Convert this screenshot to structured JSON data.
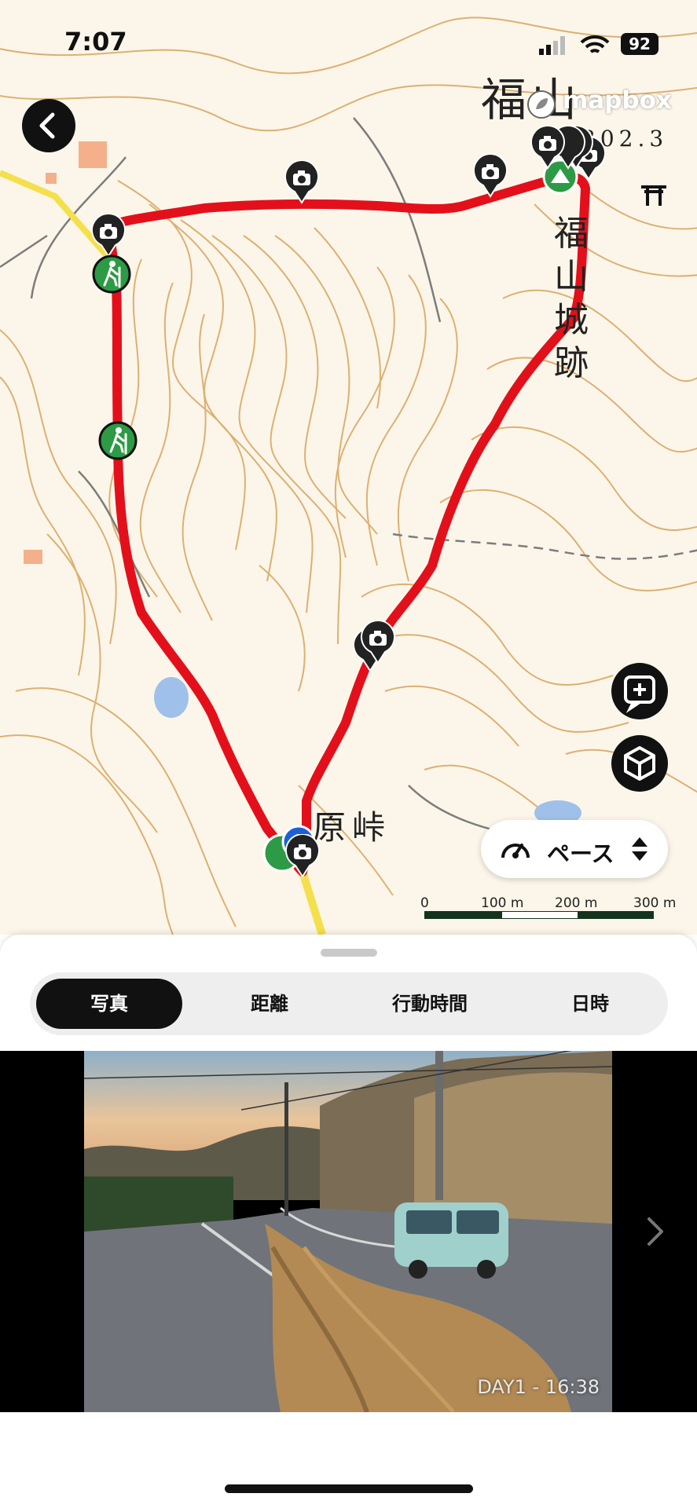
{
  "status_bar": {
    "time": "7:07",
    "battery": "92"
  },
  "map": {
    "attribution": "mapbox",
    "peak_name": "福山",
    "peak_elevation": "302.3",
    "castle_label_chars": [
      "福",
      "山",
      "城",
      "跡"
    ],
    "pass_name": "原峠",
    "pace_button_label": "ペース",
    "scale_labels": [
      "0",
      "100 m",
      "200 m",
      "300 m"
    ]
  },
  "tabs": [
    {
      "label": "写真",
      "active": true
    },
    {
      "label": "距離",
      "active": false
    },
    {
      "label": "行動時間",
      "active": false
    },
    {
      "label": "日時",
      "active": false
    }
  ],
  "photo": {
    "caption": "DAY1 - 16:38"
  },
  "colors": {
    "track": "#e3101b",
    "accent": "#111111",
    "trail_marker": "#2d9a45",
    "map_bg": "#fbf6e9",
    "contour": "#d6a25a"
  },
  "icons": [
    "back-arrow-icon",
    "camera-icon",
    "hiker-icon",
    "summit-icon",
    "add-note-icon",
    "3d-cube-icon",
    "speedometer-icon",
    "sort-arrows-icon",
    "chevron-right-icon",
    "wifi-icon",
    "signal-icon",
    "torii-icon"
  ]
}
